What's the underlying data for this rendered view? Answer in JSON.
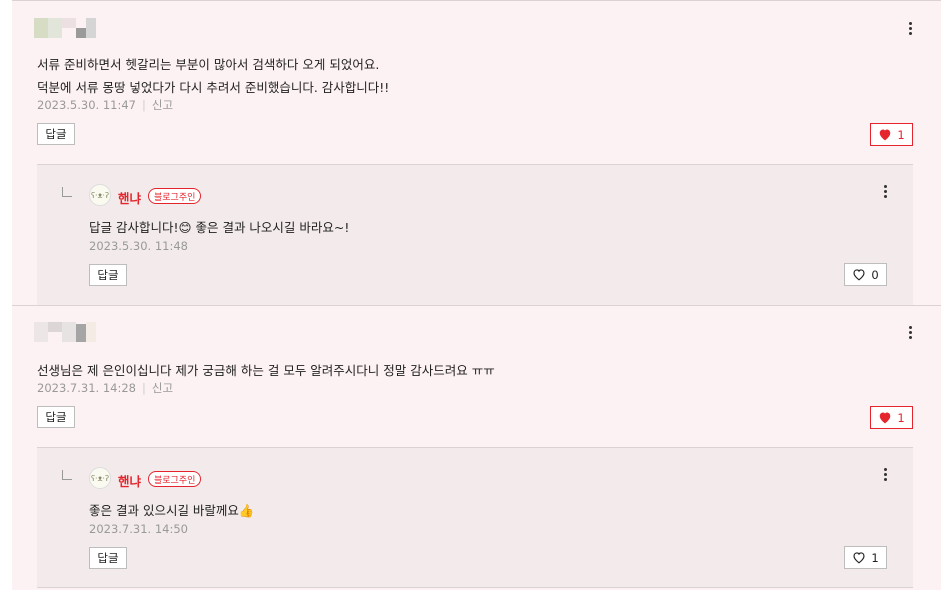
{
  "comments": [
    {
      "lines": [
        "서류 준비하면서 헷갈리는 부분이 많아서 검색하다 오게 되었어요.",
        "덕분에 서류 몽땅 넣었다가 다시 추려서 준비했습니다. 감사합니다!!"
      ],
      "time": "2023.5.30. 11:47",
      "report": "신고",
      "reply_button": "답글",
      "like_count": "1",
      "reply": {
        "avatar": "ʕ·ᴥ·ʔ",
        "author": "핸냐",
        "badge": "블로그주인",
        "text": "답글 감사합니다!😊 좋은 결과 나오시길 바라요~!",
        "time": "2023.5.30. 11:48",
        "reply_button": "답글",
        "like_count": "0"
      }
    },
    {
      "lines": [
        "선생님은 제 은인이십니다 제가 궁금해 하는 걸 모두 알려주시다니 정말 감사드려요 ㅠㅠ"
      ],
      "time": "2023.7.31. 14:28",
      "report": "신고",
      "reply_button": "답글",
      "like_count": "1",
      "reply": {
        "avatar": "ʕ·ᴥ·ʔ",
        "author": "핸냐",
        "badge": "블로그주인",
        "text": "좋은 결과 있으시길 바랄께요👍",
        "time": "2023.7.31. 14:50",
        "reply_button": "답글",
        "like_count": "1"
      }
    }
  ],
  "colors": {
    "accent": "#e4252d",
    "background": "#fdf2f3",
    "reply_background": "#f3ebeb"
  },
  "icons": {
    "like": "heart-icon",
    "more": "more-vertical-icon",
    "reply_arrow": "reply-arrow-icon"
  }
}
